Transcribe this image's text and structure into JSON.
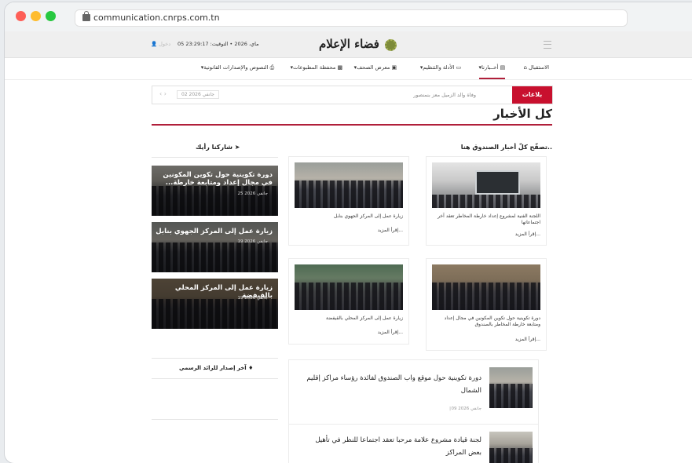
{
  "browser": {
    "url": "communication.cnrps.com.tn"
  },
  "topbar": {
    "login": "دخول",
    "datetime": "05 ماي، 2026 • التوقيت: 23:29:17",
    "logo": "فضاء الإعلام"
  },
  "nav": {
    "items": [
      {
        "label": "الاستقبال",
        "icon": "home-icon"
      },
      {
        "label": "أخــبارنا",
        "icon": "newspaper-icon"
      },
      {
        "label": "الأدلة والتنظيم",
        "icon": "folder-icon"
      },
      {
        "label": "معرض الصحف",
        "icon": "book-icon"
      },
      {
        "label": "محفظة المطبوعات",
        "icon": "archive-icon"
      },
      {
        "label": "النصوص والإصدارات القانونية",
        "icon": "print-icon"
      }
    ]
  },
  "alert": {
    "label": "بلاغات",
    "text": "وفاة والد الزميل معز بنمنصور",
    "date": "02 جانفي 2026"
  },
  "page": {
    "title": "كل الأخبار",
    "section_title": "تصفّح كلّ أخبار الصندوق هنا..",
    "share_title": "شاركنا رأيك",
    "gazette_title": "آخر إصدار للرائد الرسمي"
  },
  "cards": [
    {
      "caption": "اللجنة الفنية لمشروع إعداد خارطة المخاطر تعقد آخر اجتماعاتها",
      "more": "إقرأ المزيد..."
    },
    {
      "caption": "زيارة عمل إلى المركز الجهوي بنابل",
      "more": "إقرأ المزيد..."
    },
    {
      "caption": "دورة تكوينية حول تكوين المكونين في مجال إعداد ومتابعة خارطة المخاطر بالصندوق",
      "more": "إقرأ المزيد..."
    },
    {
      "caption": "زيارة عمل إلى المركز المحلي بالقيفضة",
      "more": "إقرأ المزيد..."
    }
  ],
  "sidebar": [
    {
      "title": "دورة تكوينية حول تكوين المكونين في مجال إعداد ومتابعة خارطة...",
      "date": "25 جانفي 2026"
    },
    {
      "title": "زيارة عمل إلى المركز الجهوي بنابل",
      "date": "19 جانفي 2026"
    },
    {
      "title": "زيارة عمل إلى المركز المحلي بالقيفضة",
      "date": "19 جانفي 2026"
    }
  ],
  "list": [
    {
      "title": "دورة تكوينية حول موقع واب الصندوق لفائدة رؤساء مراكز إقليم الشمال",
      "date": "09 جانفي 2026"
    },
    {
      "title": "لجنة قيادة مشروع علامة مرحبا تعقد اجتماعا للنظر في تأهيل بعض المراكز",
      "date": ""
    }
  ]
}
